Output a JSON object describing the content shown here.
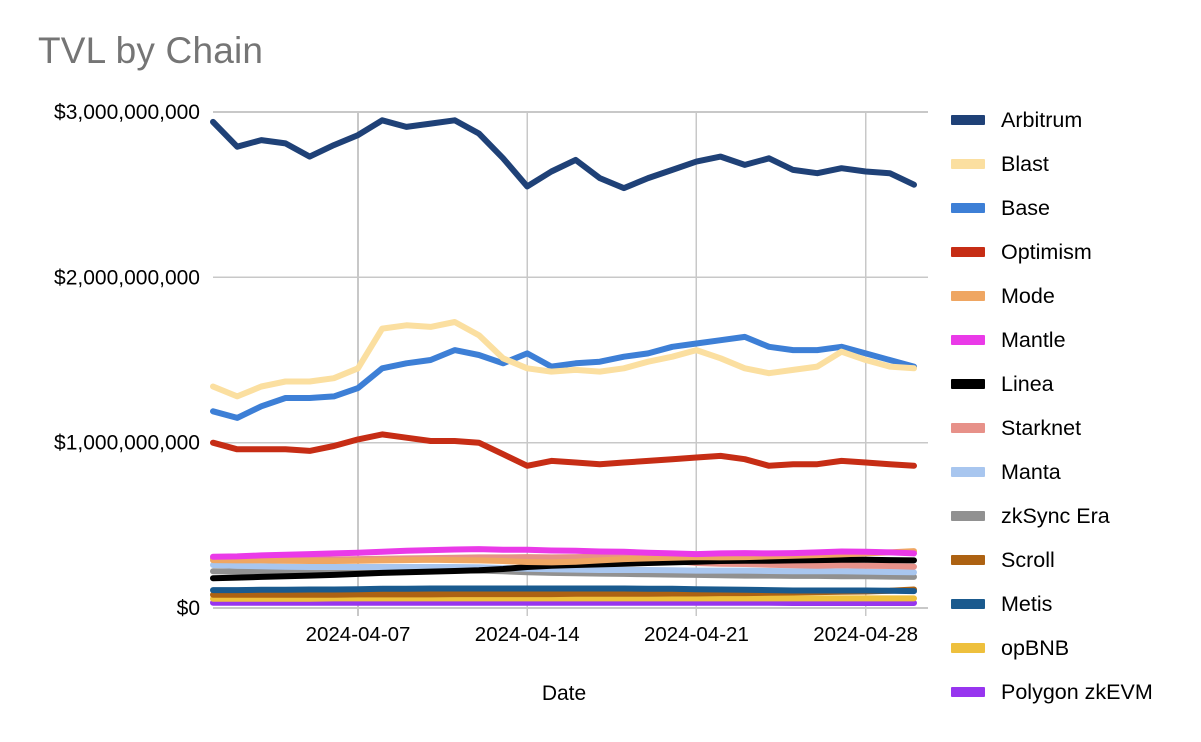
{
  "chart_data": {
    "type": "line",
    "title": "TVL by Chain",
    "xlabel": "Date",
    "ylabel": "",
    "ylim": [
      0,
      3200000000
    ],
    "grid": true,
    "legend_position": "right",
    "y_ticks": [
      "$3,000,000,000",
      "$2,000,000,000",
      "$1,000,000,000",
      "$0"
    ],
    "y_tick_values": [
      3000000000,
      2000000000,
      1000000000,
      0
    ],
    "x_ticks": [
      "2024-04-07",
      "2024-04-14",
      "2024-04-21",
      "2024-04-28"
    ],
    "x_tick_values": [
      "2024-04-07",
      "2024-04-14",
      "2024-04-21",
      "2024-04-28"
    ],
    "x": [
      "2024-04-01",
      "2024-04-02",
      "2024-04-03",
      "2024-04-04",
      "2024-04-05",
      "2024-04-06",
      "2024-04-07",
      "2024-04-08",
      "2024-04-09",
      "2024-04-10",
      "2024-04-11",
      "2024-04-12",
      "2024-04-13",
      "2024-04-14",
      "2024-04-15",
      "2024-04-16",
      "2024-04-17",
      "2024-04-18",
      "2024-04-19",
      "2024-04-20",
      "2024-04-21",
      "2024-04-22",
      "2024-04-23",
      "2024-04-24",
      "2024-04-25",
      "2024-04-26",
      "2024-04-27",
      "2024-04-28",
      "2024-04-29",
      "2024-04-30"
    ],
    "series": [
      {
        "name": "Arbitrum",
        "color": "#1f4177",
        "values": [
          2940000000,
          2790000000,
          2830000000,
          2810000000,
          2730000000,
          2800000000,
          2860000000,
          2950000000,
          2910000000,
          2930000000,
          2950000000,
          2870000000,
          2720000000,
          2550000000,
          2640000000,
          2710000000,
          2600000000,
          2540000000,
          2600000000,
          2650000000,
          2700000000,
          2730000000,
          2680000000,
          2720000000,
          2650000000,
          2630000000,
          2660000000,
          2640000000,
          2630000000,
          2560000000
        ]
      },
      {
        "name": "Blast",
        "color": "#fbdfa0",
        "values": [
          1340000000,
          1280000000,
          1340000000,
          1370000000,
          1370000000,
          1390000000,
          1450000000,
          1690000000,
          1710000000,
          1700000000,
          1730000000,
          1650000000,
          1510000000,
          1450000000,
          1430000000,
          1440000000,
          1430000000,
          1450000000,
          1490000000,
          1520000000,
          1560000000,
          1510000000,
          1450000000,
          1420000000,
          1440000000,
          1460000000,
          1550000000,
          1500000000,
          1460000000,
          1450000000
        ]
      },
      {
        "name": "Base",
        "color": "#3d7fd6",
        "values": [
          1190000000,
          1150000000,
          1220000000,
          1270000000,
          1270000000,
          1280000000,
          1330000000,
          1450000000,
          1480000000,
          1500000000,
          1560000000,
          1530000000,
          1480000000,
          1540000000,
          1460000000,
          1480000000,
          1490000000,
          1520000000,
          1540000000,
          1580000000,
          1600000000,
          1620000000,
          1640000000,
          1580000000,
          1560000000,
          1560000000,
          1580000000,
          1540000000,
          1500000000,
          1460000000
        ]
      },
      {
        "name": "Optimism",
        "color": "#c62d15",
        "values": [
          1000000000,
          960000000,
          960000000,
          960000000,
          950000000,
          980000000,
          1020000000,
          1050000000,
          1030000000,
          1010000000,
          1010000000,
          1000000000,
          930000000,
          860000000,
          890000000,
          880000000,
          870000000,
          880000000,
          890000000,
          900000000,
          910000000,
          920000000,
          900000000,
          860000000,
          870000000,
          870000000,
          890000000,
          880000000,
          870000000,
          860000000
        ]
      },
      {
        "name": "Mode",
        "color": "#efa662",
        "values": [
          290000000,
          288000000,
          288000000,
          286000000,
          284000000,
          284000000,
          286000000,
          288000000,
          290000000,
          292000000,
          290000000,
          288000000,
          284000000,
          278000000,
          276000000,
          280000000,
          288000000,
          296000000,
          300000000,
          304000000,
          308000000,
          306000000,
          308000000,
          312000000,
          316000000,
          320000000,
          324000000,
          330000000,
          336000000,
          344000000
        ]
      },
      {
        "name": "Mantle",
        "color": "#ea3ae8",
        "values": [
          310000000,
          312000000,
          318000000,
          322000000,
          326000000,
          330000000,
          334000000,
          340000000,
          346000000,
          350000000,
          354000000,
          356000000,
          352000000,
          352000000,
          348000000,
          346000000,
          342000000,
          340000000,
          334000000,
          330000000,
          326000000,
          330000000,
          332000000,
          330000000,
          332000000,
          336000000,
          342000000,
          340000000,
          336000000,
          330000000
        ]
      },
      {
        "name": "Linea",
        "color": "#000000",
        "values": [
          180000000,
          184000000,
          188000000,
          192000000,
          196000000,
          200000000,
          206000000,
          212000000,
          216000000,
          220000000,
          224000000,
          228000000,
          236000000,
          248000000,
          256000000,
          260000000,
          264000000,
          268000000,
          272000000,
          276000000,
          280000000,
          284000000,
          286000000,
          286000000,
          288000000,
          290000000,
          292000000,
          292000000,
          290000000,
          288000000
        ]
      },
      {
        "name": "Starknet",
        "color": "#e79189"
      },
      {
        "name": "Manta",
        "color": "#a8c6ef"
      },
      {
        "name": "zkSync Era",
        "color": "#919191"
      },
      {
        "name": "Scroll",
        "color": "#ad6212"
      },
      {
        "name": "Metis",
        "color": "#1a5a8e"
      },
      {
        "name": "opBNB",
        "color": "#eec03d"
      },
      {
        "name": "Polygon zkEVM",
        "color": "#9735ef"
      }
    ],
    "series_extra": {
      "Starknet": [
        300000000,
        298000000,
        296000000,
        296000000,
        294000000,
        294000000,
        296000000,
        298000000,
        300000000,
        302000000,
        304000000,
        306000000,
        306000000,
        308000000,
        306000000,
        308000000,
        310000000,
        308000000,
        300000000,
        284000000,
        272000000,
        268000000,
        266000000,
        262000000,
        258000000,
        256000000,
        258000000,
        256000000,
        254000000,
        250000000
      ],
      "Manta": [
        260000000,
        256000000,
        252000000,
        250000000,
        248000000,
        248000000,
        248000000,
        248000000,
        248000000,
        248000000,
        248000000,
        246000000,
        242000000,
        238000000,
        234000000,
        232000000,
        230000000,
        230000000,
        230000000,
        228000000,
        226000000,
        226000000,
        226000000,
        224000000,
        222000000,
        222000000,
        222000000,
        220000000,
        218000000,
        216000000
      ],
      "zkSync Era": [
        222000000,
        220000000,
        220000000,
        222000000,
        222000000,
        222000000,
        224000000,
        226000000,
        228000000,
        228000000,
        228000000,
        226000000,
        222000000,
        216000000,
        212000000,
        210000000,
        208000000,
        206000000,
        204000000,
        202000000,
        200000000,
        198000000,
        196000000,
        196000000,
        194000000,
        194000000,
        192000000,
        192000000,
        190000000,
        188000000
      ],
      "Metis": [
        108000000,
        108000000,
        110000000,
        110000000,
        112000000,
        112000000,
        114000000,
        116000000,
        116000000,
        118000000,
        118000000,
        118000000,
        118000000,
        118000000,
        118000000,
        118000000,
        118000000,
        118000000,
        116000000,
        116000000,
        114000000,
        112000000,
        110000000,
        108000000,
        106000000,
        106000000,
        106000000,
        106000000,
        104000000,
        102000000
      ],
      "Scroll": [
        80000000,
        80000000,
        80000000,
        80000000,
        80000000,
        80000000,
        82000000,
        82000000,
        82000000,
        82000000,
        84000000,
        84000000,
        84000000,
        84000000,
        84000000,
        86000000,
        86000000,
        86000000,
        86000000,
        88000000,
        88000000,
        90000000,
        90000000,
        92000000,
        94000000,
        96000000,
        98000000,
        100000000,
        104000000,
        112000000
      ],
      "opBNB": [
        56000000,
        56000000,
        56000000,
        56000000,
        56000000,
        58000000,
        58000000,
        58000000,
        58000000,
        58000000,
        58000000,
        58000000,
        58000000,
        58000000,
        58000000,
        58000000,
        58000000,
        58000000,
        58000000,
        58000000,
        58000000,
        58000000,
        58000000,
        58000000,
        58000000,
        58000000,
        58000000,
        58000000,
        58000000,
        58000000
      ],
      "Polygon zkEVM": [
        32000000,
        32000000,
        32000000,
        32000000,
        32000000,
        32000000,
        32000000,
        32000000,
        32000000,
        32000000,
        32000000,
        32000000,
        32000000,
        32000000,
        32000000,
        32000000,
        32000000,
        32000000,
        32000000,
        32000000,
        32000000,
        32000000,
        32000000,
        32000000,
        30000000,
        30000000,
        30000000,
        30000000,
        30000000,
        30000000
      ]
    }
  },
  "legend": {
    "items": [
      {
        "label": "Arbitrum"
      },
      {
        "label": "Blast"
      },
      {
        "label": "Base"
      },
      {
        "label": "Optimism"
      },
      {
        "label": "Mode"
      },
      {
        "label": "Mantle"
      },
      {
        "label": "Linea"
      },
      {
        "label": "Starknet"
      },
      {
        "label": "Manta"
      },
      {
        "label": "zkSync Era"
      },
      {
        "label": "Scroll"
      },
      {
        "label": "Metis"
      },
      {
        "label": "opBNB"
      },
      {
        "label": "Polygon zkEVM"
      }
    ]
  }
}
